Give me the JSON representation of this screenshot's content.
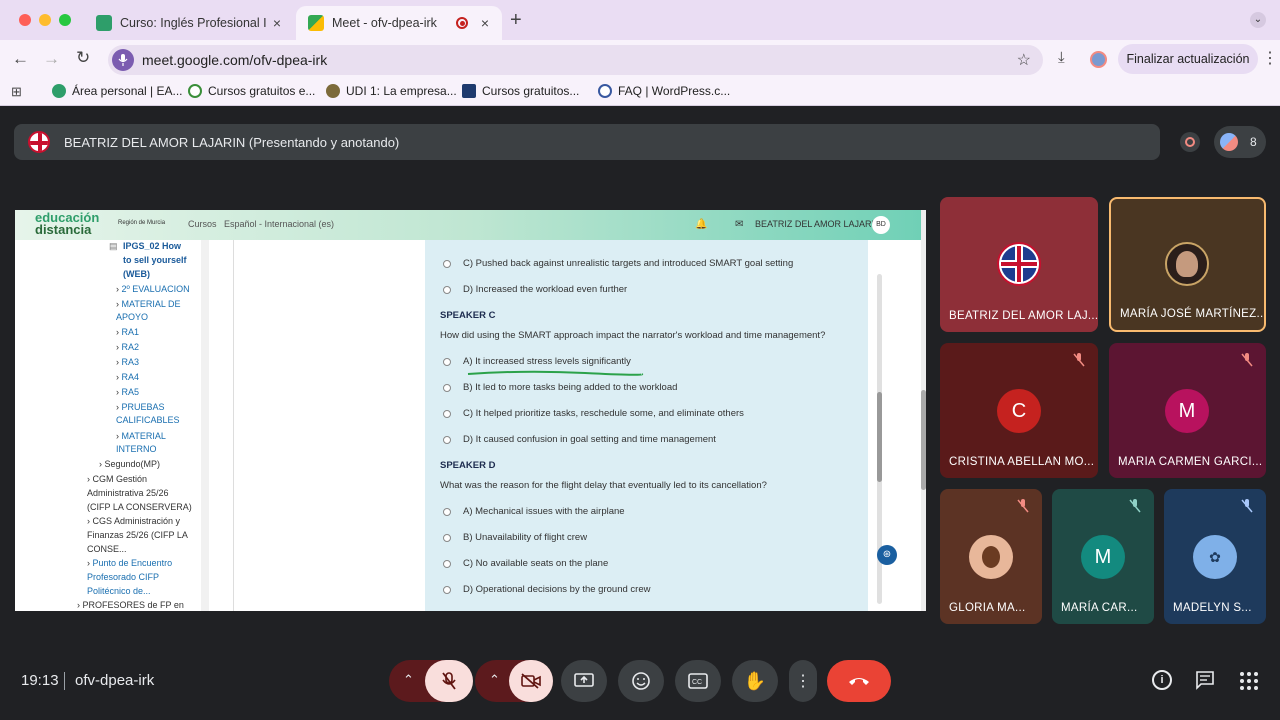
{
  "browser": {
    "tabs": [
      {
        "label": "Curso: Inglés Profesional I pa",
        "close": "×"
      },
      {
        "label": "Meet - ofv-dpea-irk",
        "close": "×"
      }
    ],
    "new_tab": "+",
    "url": "meet.google.com/ofv-dpea-irk",
    "update_button": "Finalizar actualización",
    "bookmarks": [
      "Área personal | EA...",
      "Cursos gratuitos e...",
      "UDI 1: La empresa...",
      "Cursos gratuitos...",
      "FAQ | WordPress.c..."
    ]
  },
  "meet": {
    "presenter_label": "BEATRIZ DEL AMOR LAJARIN (Presentando y anotando)",
    "participant_count": "8",
    "time": "19:13",
    "meeting_code": "ofv-dpea-irk",
    "tiles": [
      {
        "name": "BEATRIZ DEL AMOR LAJ...",
        "initial": ""
      },
      {
        "name": "MARÍA JOSÉ MARTÍNEZ...",
        "initial": ""
      },
      {
        "name": "CRISTINA ABELLAN MO...",
        "initial": "C"
      },
      {
        "name": "MARIA CARMEN GARCI...",
        "initial": "M"
      },
      {
        "name": "GLORIA MA...",
        "initial": ""
      },
      {
        "name": "MARÍA CAR...",
        "initial": "M"
      },
      {
        "name": "MADELYN S...",
        "initial": ""
      }
    ],
    "colors": {
      "accent": "#f8ba6f",
      "hangup": "#ea4335",
      "muted_bg": "#f9dedc"
    }
  },
  "shared": {
    "logo": {
      "line1": "educación",
      "line2": "distancia",
      "region": "Región de Murcia"
    },
    "nav": {
      "cursos": "Cursos",
      "language": "Español - Internacional (es)",
      "user": "BEATRIZ DEL AMOR LAJARIN",
      "initials": "BD"
    },
    "sidebar": [
      "IPGS_02 How",
      "to sell yourself",
      "(WEB)",
      "2º EVALUACION",
      "MATERIAL DE",
      "APOYO",
      "RA1",
      "RA2",
      "RA3",
      "RA4",
      "RA5",
      "PRUEBAS",
      "CALIFICABLES",
      "MATERIAL",
      "INTERNO",
      "Segundo(MP)",
      "CGM Gestión",
      "Administrativa 25/26",
      "(CIFP LA CONSERVERA)",
      "CGS Administración y",
      "Finanzas 25/26 (CIFP LA",
      "CONSE...",
      "Punto de Encuentro",
      "Profesorado CIFP",
      "Politécnico de...",
      "PROFESORES de FP en"
    ],
    "questions": {
      "prev_options": [
        "C) Pushed back against unrealistic targets and introduced SMART goal setting",
        "D) Increased the workload even further"
      ],
      "speaker_c": "SPEAKER C",
      "q_c": "How did using the SMART approach impact the narrator's workload and time management?",
      "opts_c": [
        "A) It increased stress levels significantly",
        "B) It led to more tasks being added to the workload",
        "C) It helped prioritize tasks, reschedule some, and eliminate others",
        "D) It caused confusion in goal setting and time management"
      ],
      "speaker_d": "SPEAKER D",
      "q_d": "What was the reason for the flight delay that eventually led to its cancellation?",
      "opts_d": [
        "A) Mechanical issues with the airplane",
        "B) Unavailability of flight crew",
        "C) No available seats on the plane",
        "D) Operational decisions by the ground crew"
      ]
    }
  }
}
